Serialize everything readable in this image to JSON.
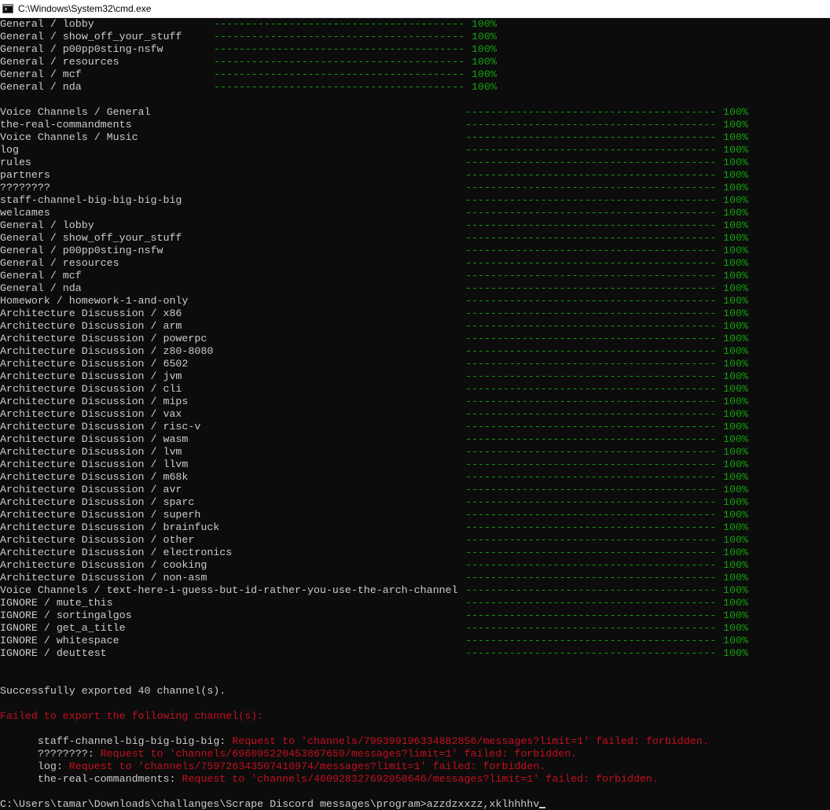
{
  "window": {
    "title": "C:\\Windows\\System32\\cmd.exe",
    "icon": "cmd-icon"
  },
  "colors": {
    "background": "#0c0c0c",
    "text": "#cccccc",
    "progress": "#13a10e",
    "error": "#c50f1f"
  },
  "progress_groups": [
    {
      "items": [
        {
          "name": "General / lobby",
          "percent": "100%"
        },
        {
          "name": "General / show_off_your_stuff",
          "percent": "100%"
        },
        {
          "name": "General / p00pp0sting-nsfw",
          "percent": "100%"
        },
        {
          "name": "General / resources",
          "percent": "100%"
        },
        {
          "name": "General / mcf",
          "percent": "100%"
        },
        {
          "name": "General / nda",
          "percent": "100%"
        }
      ]
    },
    {
      "items": [
        {
          "name": "Voice Channels / General",
          "percent": "100%"
        },
        {
          "name": "the-real-commandments",
          "percent": "100%"
        },
        {
          "name": "Voice Channels / Music",
          "percent": "100%"
        },
        {
          "name": "log",
          "percent": "100%"
        },
        {
          "name": "rules",
          "percent": "100%"
        },
        {
          "name": "partners",
          "percent": "100%"
        },
        {
          "name": "????????",
          "percent": "100%"
        },
        {
          "name": "staff-channel-big-big-big-big",
          "percent": "100%"
        },
        {
          "name": "welcames",
          "percent": "100%"
        },
        {
          "name": "General / lobby",
          "percent": "100%"
        },
        {
          "name": "General / show_off_your_stuff",
          "percent": "100%"
        },
        {
          "name": "General / p00pp0sting-nsfw",
          "percent": "100%"
        },
        {
          "name": "General / resources",
          "percent": "100%"
        },
        {
          "name": "General / mcf",
          "percent": "100%"
        },
        {
          "name": "General / nda",
          "percent": "100%"
        },
        {
          "name": "Homework / homework-1-and-only",
          "percent": "100%"
        },
        {
          "name": "Architecture Discussion / x86",
          "percent": "100%"
        },
        {
          "name": "Architecture Discussion / arm",
          "percent": "100%"
        },
        {
          "name": "Architecture Discussion / powerpc",
          "percent": "100%"
        },
        {
          "name": "Architecture Discussion / z80-8080",
          "percent": "100%"
        },
        {
          "name": "Architecture Discussion / 6502",
          "percent": "100%"
        },
        {
          "name": "Architecture Discussion / jvm",
          "percent": "100%"
        },
        {
          "name": "Architecture Discussion / cli",
          "percent": "100%"
        },
        {
          "name": "Architecture Discussion / mips",
          "percent": "100%"
        },
        {
          "name": "Architecture Discussion / vax",
          "percent": "100%"
        },
        {
          "name": "Architecture Discussion / risc-v",
          "percent": "100%"
        },
        {
          "name": "Architecture Discussion / wasm",
          "percent": "100%"
        },
        {
          "name": "Architecture Discussion / lvm",
          "percent": "100%"
        },
        {
          "name": "Architecture Discussion / llvm",
          "percent": "100%"
        },
        {
          "name": "Architecture Discussion / m68k",
          "percent": "100%"
        },
        {
          "name": "Architecture Discussion / avr",
          "percent": "100%"
        },
        {
          "name": "Architecture Discussion / sparc",
          "percent": "100%"
        },
        {
          "name": "Architecture Discussion / superh",
          "percent": "100%"
        },
        {
          "name": "Architecture Discussion / brainfuck",
          "percent": "100%"
        },
        {
          "name": "Architecture Discussion / other",
          "percent": "100%"
        },
        {
          "name": "Architecture Discussion / electronics",
          "percent": "100%"
        },
        {
          "name": "Architecture Discussion / cooking",
          "percent": "100%"
        },
        {
          "name": "Architecture Discussion / non-asm",
          "percent": "100%"
        },
        {
          "name": "Voice Channels / text-here-i-guess-but-id-rather-you-use-the-arch-channel",
          "percent": "100%"
        },
        {
          "name": "IGNORE / mute_this",
          "percent": "100%"
        },
        {
          "name": "IGNORE / sortingalgos",
          "percent": "100%"
        },
        {
          "name": "IGNORE / get_a_title",
          "percent": "100%"
        },
        {
          "name": "IGNORE / whitespace",
          "percent": "100%"
        },
        {
          "name": "IGNORE / deuttest",
          "percent": "100%"
        }
      ]
    }
  ],
  "summary": {
    "success": "Successfully exported 40 channel(s).",
    "failed_header": "Failed to export the following channel(s):",
    "failures": [
      {
        "channel": "staff-channel-big-big-big-big:",
        "message": " Request to 'channels/799399196334882856/messages?limit=1' failed: forbidden."
      },
      {
        "channel": "????????:",
        "message": " Request to 'channels/696095220453867650/messages?limit=1' failed: forbidden."
      },
      {
        "channel": "log:",
        "message": " Request to 'channels/759726343507410974/messages?limit=1' failed: forbidden."
      },
      {
        "channel": "the-real-commandments:",
        "message": " Request to 'channels/460928327692058646/messages?limit=1' failed: forbidden."
      }
    ]
  },
  "prompt": {
    "path": "C:\\Users\\tamar\\Downloads\\challanges\\Scrape Discord messages\\program>",
    "input": "azzdzxxzz,xklhhhhv"
  }
}
